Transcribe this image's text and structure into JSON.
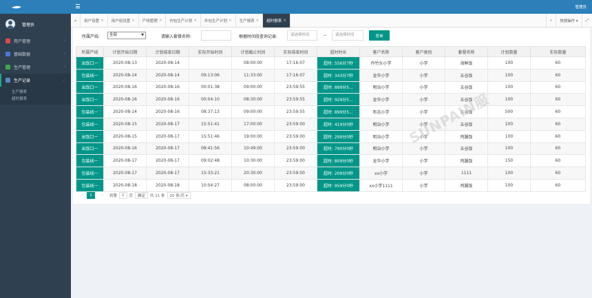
{
  "sidebar": {
    "username": "管理员",
    "items": [
      {
        "label": "用户管理",
        "icon": "user-icon",
        "color": "#e24a4a"
      },
      {
        "label": "基础数据",
        "icon": "database-icon",
        "color": "#4a78d6"
      },
      {
        "label": "生产管理",
        "icon": "wrench-icon",
        "color": "#3aa84a"
      },
      {
        "label": "生产记录",
        "icon": "record-icon",
        "color": "#5a86c8"
      }
    ],
    "subitems": [
      "生产报表",
      "超时报表"
    ]
  },
  "topbar": {
    "user": "管理员"
  },
  "tabs": [
    {
      "label": "用户设置"
    },
    {
      "label": "用户组设置"
    },
    {
      "label": "产线管理"
    },
    {
      "label": "内包生产计划"
    },
    {
      "label": "外包生产计划"
    },
    {
      "label": "生产报表"
    },
    {
      "label": "超时报表"
    }
  ],
  "tab_right": {
    "quick": "快捷操作 ▾"
  },
  "filter": {
    "line_label": "所属产线:",
    "line_value": "全部",
    "meal_label": "请输入套餐名称:",
    "time_label": "根据时间段查询记录:",
    "start_placeholder": "请选择时间",
    "sep": "--",
    "end_placeholder": "请选择时间",
    "query": "查询"
  },
  "table": {
    "headers": [
      "所属产线",
      "计划开始日期",
      "计划结束日期",
      "实际开始时间",
      "计划截止时间",
      "实际结束时间",
      "超时时长",
      "客户名称",
      "客户类别",
      "套餐名称",
      "计划数量",
      "实际数量"
    ],
    "rows": [
      [
        "出饭口一",
        "2020-08-13",
        "2020-08-14",
        "",
        "08:00:00",
        "17:16:07",
        "超时: 556分7秒",
        "丹竹头小学",
        "小学",
        "海鲜饭",
        "100",
        "60"
      ],
      [
        "包装线一",
        "2020-08-14",
        "2020-08-14",
        "09:13:06",
        "11:33:00",
        "17:16:07",
        "超时: 343分7秒",
        "龙华小学",
        "小学",
        "五谷饭",
        "100",
        "60"
      ],
      [
        "出饭口一",
        "2020-08-16",
        "2020-08-16",
        "00:01:38",
        "09:00:00",
        "23:59:55",
        "超时: 899分5...",
        "明治小学",
        "小学",
        "五谷饭",
        "100",
        "60"
      ],
      [
        "出饭口一",
        "2020-08-16",
        "2020-08-16",
        "00:04:10",
        "08:30:00",
        "23:59:55",
        "超时: 929分5...",
        "龙华小学",
        "小学",
        "五谷饭",
        "100",
        "60"
      ],
      [
        "包装线一",
        "2020-08-14",
        "2020-08-16",
        "08:37:13",
        "09:00:00",
        "23:59:55",
        "超时: 899分5...",
        "布吉小学",
        "小学",
        "五谷饭",
        "500",
        "60"
      ],
      [
        "包装线一",
        "2020-08-15",
        "2020-08-17",
        "15:51:41",
        "17:00:00",
        "23:59:00",
        "超时: 419分0秒",
        "明治小学",
        "小学",
        "五谷饭",
        "100",
        "60"
      ],
      [
        "出饭口一",
        "2020-08-15",
        "2020-08-17",
        "15:51:46",
        "19:00:00",
        "23:59:00",
        "超时: 299分0秒",
        "明治小学",
        "小学",
        "鸡腿饭",
        "100",
        "60"
      ],
      [
        "出饭口一",
        "2020-08-16",
        "2020-08-17",
        "08:41:56",
        "10:49:00",
        "23:59:00",
        "超时: 790分0秒",
        "明治小学",
        "小学",
        "五谷饭",
        "100",
        "60"
      ],
      [
        "包装线一",
        "2020-08-17",
        "2020-08-17",
        "09:02:48",
        "10:30:00",
        "23:59:00",
        "超时: 809分0秒",
        "龙华小学",
        "小学",
        "鸡腿饭",
        "150",
        "60"
      ],
      [
        "包装线一",
        "2020-08-17",
        "2020-08-17",
        "15:33:21",
        "20:30:00",
        "23:59:00",
        "超时: 209分0秒",
        "xx小学",
        "小学",
        "1111",
        "100",
        "60"
      ],
      [
        "包装线一",
        "2020-08-18",
        "2020-08-18",
        "10:04:27",
        "08:00:00",
        "23:59:00",
        "超时: 959分0秒",
        "xx小学1111",
        "小学",
        "鸡腿饭",
        "100",
        "60"
      ]
    ]
  },
  "pager": {
    "prev": "‹",
    "current": "1",
    "next": "›",
    "goto_label": "到第",
    "page_input": "1",
    "page_unit": "页",
    "confirm": "确定",
    "total": "共 11 条",
    "per_page": "20 条/页 ▾"
  },
  "watermark": "SUNPAIN服"
}
